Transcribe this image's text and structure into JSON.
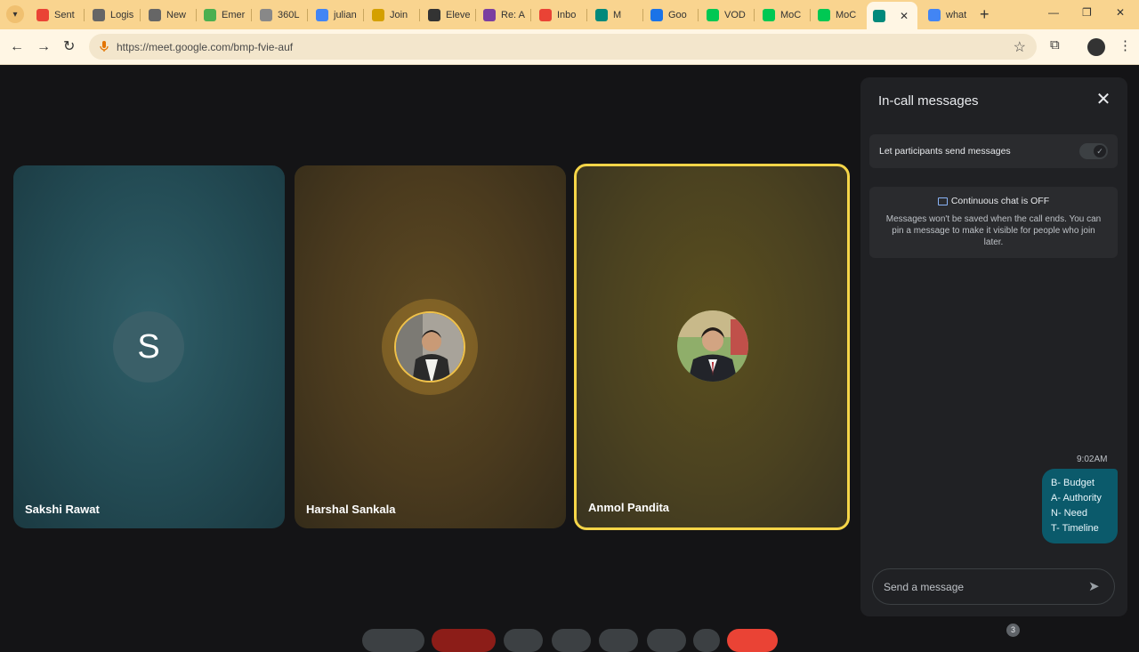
{
  "browser": {
    "tabs": [
      {
        "label": "Sent",
        "icon": "gmail-icon",
        "color": "#ea4335"
      },
      {
        "label": "Logis",
        "icon": "info-icon",
        "color": "#666666"
      },
      {
        "label": "New",
        "icon": "info-icon",
        "color": "#666666"
      },
      {
        "label": "Emer",
        "icon": "green-logo-icon",
        "color": "#4caf50"
      },
      {
        "label": "360L",
        "icon": "ring-icon",
        "color": "#888888"
      },
      {
        "label": "julian",
        "icon": "google-icon",
        "color": "#4285f4"
      },
      {
        "label": "Join",
        "icon": "circle-logo-icon",
        "color": "#d4a000"
      },
      {
        "label": "Eleve",
        "icon": "pause-icon",
        "color": "#333333"
      },
      {
        "label": "Re: A",
        "icon": "hash-icon",
        "color": "#7b3fa0"
      },
      {
        "label": "Inbo",
        "icon": "gmail-icon",
        "color": "#ea4335"
      },
      {
        "label": "M",
        "icon": "meet-icon",
        "color": "#00897b"
      },
      {
        "label": "Goo",
        "icon": "calendar-icon",
        "color": "#1a73e8"
      },
      {
        "label": "VOD",
        "icon": "k-icon",
        "color": "#00c853"
      },
      {
        "label": "MoC",
        "icon": "k-icon",
        "color": "#00c853"
      },
      {
        "label": "MoC",
        "icon": "k-icon",
        "color": "#00c853"
      },
      {
        "label": "",
        "icon": "meet-recording-icon",
        "color": "#00897b"
      },
      {
        "label": "what",
        "icon": "google-icon",
        "color": "#4285f4"
      }
    ],
    "new_tab_label": "+",
    "url": "https://meet.google.com/bmp-fvie-auf"
  },
  "participants": [
    {
      "name": "Sakshi Rawat",
      "initial": "S"
    },
    {
      "name": "Harshal Sankala"
    },
    {
      "name": "Anmol Pandita"
    }
  ],
  "chat": {
    "title": "In-call messages",
    "permission_label": "Let participants send messages",
    "continuous_title": "Continuous chat is OFF",
    "continuous_text": "Messages won't be saved when the call ends. You can pin a message to make it visible for people who join later.",
    "message_time": "9:02AM",
    "message_lines": [
      "B- Budget",
      "A- Authority",
      "N- Need",
      "T- Timeline"
    ],
    "compose_placeholder": "Send a message"
  },
  "controls": {
    "people_count": "3"
  },
  "colors": {
    "active_speaker_border": "#f5d548",
    "bubble": "#0b5a6b",
    "chrome": "#f9d48f",
    "leave_button": "#ea4335"
  }
}
